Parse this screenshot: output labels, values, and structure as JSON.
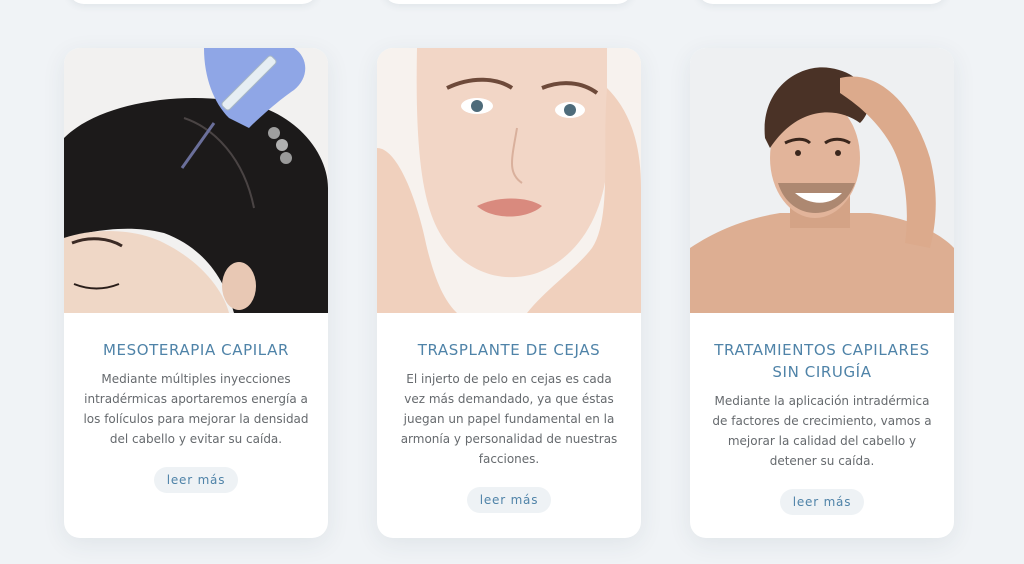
{
  "cards": [
    {
      "title": "MESOTERAPIA CAPILAR",
      "description": "Mediante múltiples inyecciones intradérmicas aportaremos energía a los folículos para mejorar la densidad del cabello y evitar su caída.",
      "button": "leer más",
      "image_icon": "woman-scalp-injection-photo"
    },
    {
      "title": "TRASPLANTE DE CEJAS",
      "description": "El injerto de pelo en cejas es cada vez más demandado, ya que éstas juegan un papel fundamental en la armonía y personalidad de nuestras facciones.",
      "button": "leer más",
      "image_icon": "woman-face-portrait-photo"
    },
    {
      "title": "TRATAMIENTOS CAPILARES SIN CIRUGÍA",
      "description": "Mediante la aplicación intradérmica de factores de crecimiento, vamos a mejorar la calidad del cabello y detener su caída.",
      "button": "leer más",
      "image_icon": "smiling-man-hair-photo"
    }
  ],
  "colors": {
    "background": "#f0f3f6",
    "card": "#ffffff",
    "title": "#4f83a8",
    "text": "#666a6e",
    "button_bg": "#eef2f5"
  }
}
